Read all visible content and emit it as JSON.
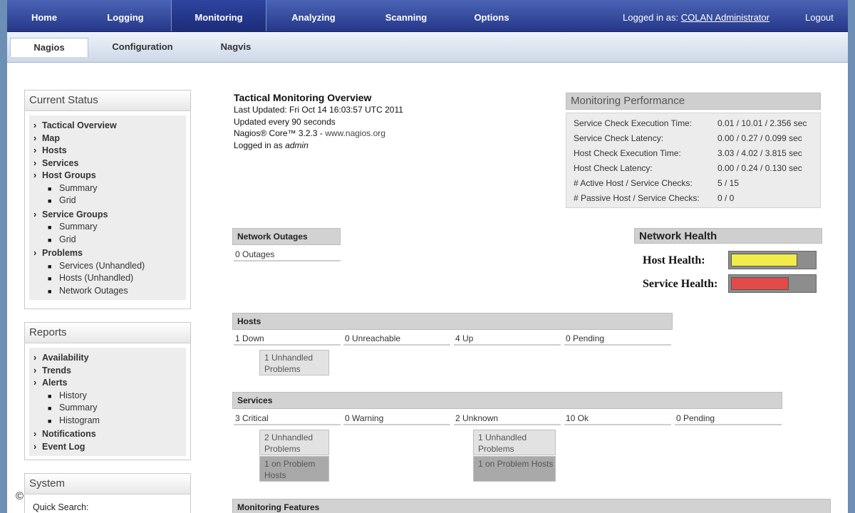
{
  "topnav": {
    "items": [
      "Home",
      "Logging",
      "Monitoring",
      "Analyzing",
      "Scanning",
      "Options"
    ],
    "active": "Monitoring",
    "login_prefix": "Logged in as:",
    "login_user": "COLAN Administrator",
    "logout": "Logout"
  },
  "subnav": {
    "tabs": [
      "Nagios",
      "Configuration",
      "Nagvis"
    ],
    "active": "Nagios"
  },
  "current_status": {
    "title": "Current Status",
    "items": {
      "tactical": "Tactical Overview",
      "map": "Map",
      "hosts": "Hosts",
      "services": "Services",
      "host_groups": "Host Groups",
      "hg_summary": "Summary",
      "hg_grid": "Grid",
      "service_groups": "Service Groups",
      "sg_summary": "Summary",
      "sg_grid": "Grid",
      "problems": "Problems",
      "services_unhandled": "Services (Unhandled)",
      "hosts_unhandled": "Hosts (Unhandled)",
      "network_outages": "Network Outages"
    }
  },
  "reports": {
    "title": "Reports",
    "items": {
      "availability": "Availability",
      "trends": "Trends",
      "alerts": "Alerts",
      "history": "History",
      "summary": "Summary",
      "histogram": "Histogram",
      "notifications": "Notifications",
      "event_log": "Event Log"
    }
  },
  "system": {
    "title": "System",
    "quick_search": "Quick Search:"
  },
  "overview": {
    "title": "Tactical Monitoring Overview",
    "last_updated": "Last Updated: Fri Oct 14 16:03:57 UTC 2011",
    "update_interval": "Updated every 90 seconds",
    "core_prefix": "Nagios® Core™ 3.2.3 - ",
    "core_link": "www.nagios.org",
    "logged_prefix": "Logged in as ",
    "logged_user": "admin"
  },
  "performance": {
    "title": "Monitoring Performance",
    "rows": [
      {
        "label": "Service Check Execution Time:",
        "value": "0.01 / 10.01 / 2.356 sec"
      },
      {
        "label": "Service Check Latency:",
        "value": "0.00 / 0.27 / 0.099 sec"
      },
      {
        "label": "Host Check Execution Time:",
        "value": "3.03 / 4.02 / 3.815 sec"
      },
      {
        "label": "Host Check Latency:",
        "value": "0.00 / 0.24 / 0.130 sec"
      },
      {
        "label": "# Active Host / Service Checks:",
        "value": "5 / 15"
      },
      {
        "label": "# Passive Host / Service Checks:",
        "value": "0 / 0"
      }
    ]
  },
  "outages": {
    "title": "Network Outages",
    "value": "0 Outages"
  },
  "network_health": {
    "title": "Network Health",
    "host_label": "Host Health:",
    "service_label": "Service Health:",
    "host_level": 0.8,
    "service_level": 0.7,
    "host_color": "#f2ec4a",
    "service_color": "#e34a4a"
  },
  "hosts": {
    "title": "Hosts",
    "down": "1 Down",
    "unreachable": "0 Unreachable",
    "up": "4 Up",
    "pending": "0 Pending",
    "down_unhandled": "1 Unhandled Problems"
  },
  "services": {
    "title": "Services",
    "critical": "3 Critical",
    "warning": "0 Warning",
    "unknown": "2 Unknown",
    "ok": "10 Ok",
    "pending": "0 Pending",
    "critical_unhandled": "2 Unhandled Problems",
    "critical_on_problem_hosts": "1 on Problem Hosts",
    "unknown_unhandled": "1 Unhandled Problems",
    "unknown_on_problem_hosts": "1 on Problem Hosts"
  },
  "monitoring_features": {
    "title": "Monitoring Features"
  },
  "footer": {
    "copyright_symbol": "©"
  }
}
